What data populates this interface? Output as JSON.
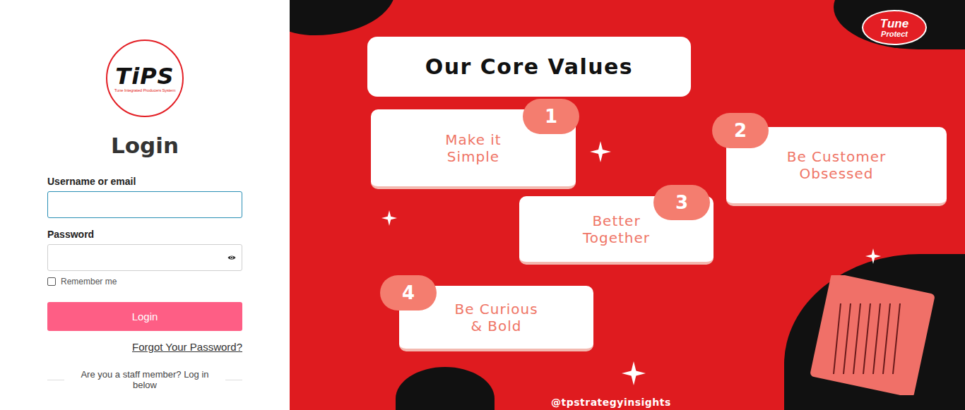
{
  "logo": {
    "text": "TiPS",
    "subtitle": "Tune Integrated Producers System"
  },
  "title": "Login",
  "fields": [
    {
      "label": "Username or email",
      "value": "",
      "kind": "text",
      "focused": true
    },
    {
      "label": "Password",
      "value": "",
      "kind": "password",
      "focused": false
    }
  ],
  "remember": {
    "label": "Remember me",
    "checked": false
  },
  "login_button": "Login",
  "forgot_link": "Forgot Your Password?",
  "staff_divider": "Are you a staff member? Log in below",
  "poster": {
    "title": "Our Core Values",
    "brand": [
      "Tune",
      "Protect"
    ],
    "values": [
      {
        "number": "1",
        "lines": [
          "Make it",
          "Simple"
        ]
      },
      {
        "number": "2",
        "lines": [
          "Be Customer",
          "Obsessed"
        ]
      },
      {
        "number": "3",
        "lines": [
          "Better",
          "Together"
        ]
      },
      {
        "number": "4",
        "lines": [
          "Be Curious",
          "& Bold"
        ]
      }
    ],
    "handle": "@tpstrategyinsights"
  }
}
